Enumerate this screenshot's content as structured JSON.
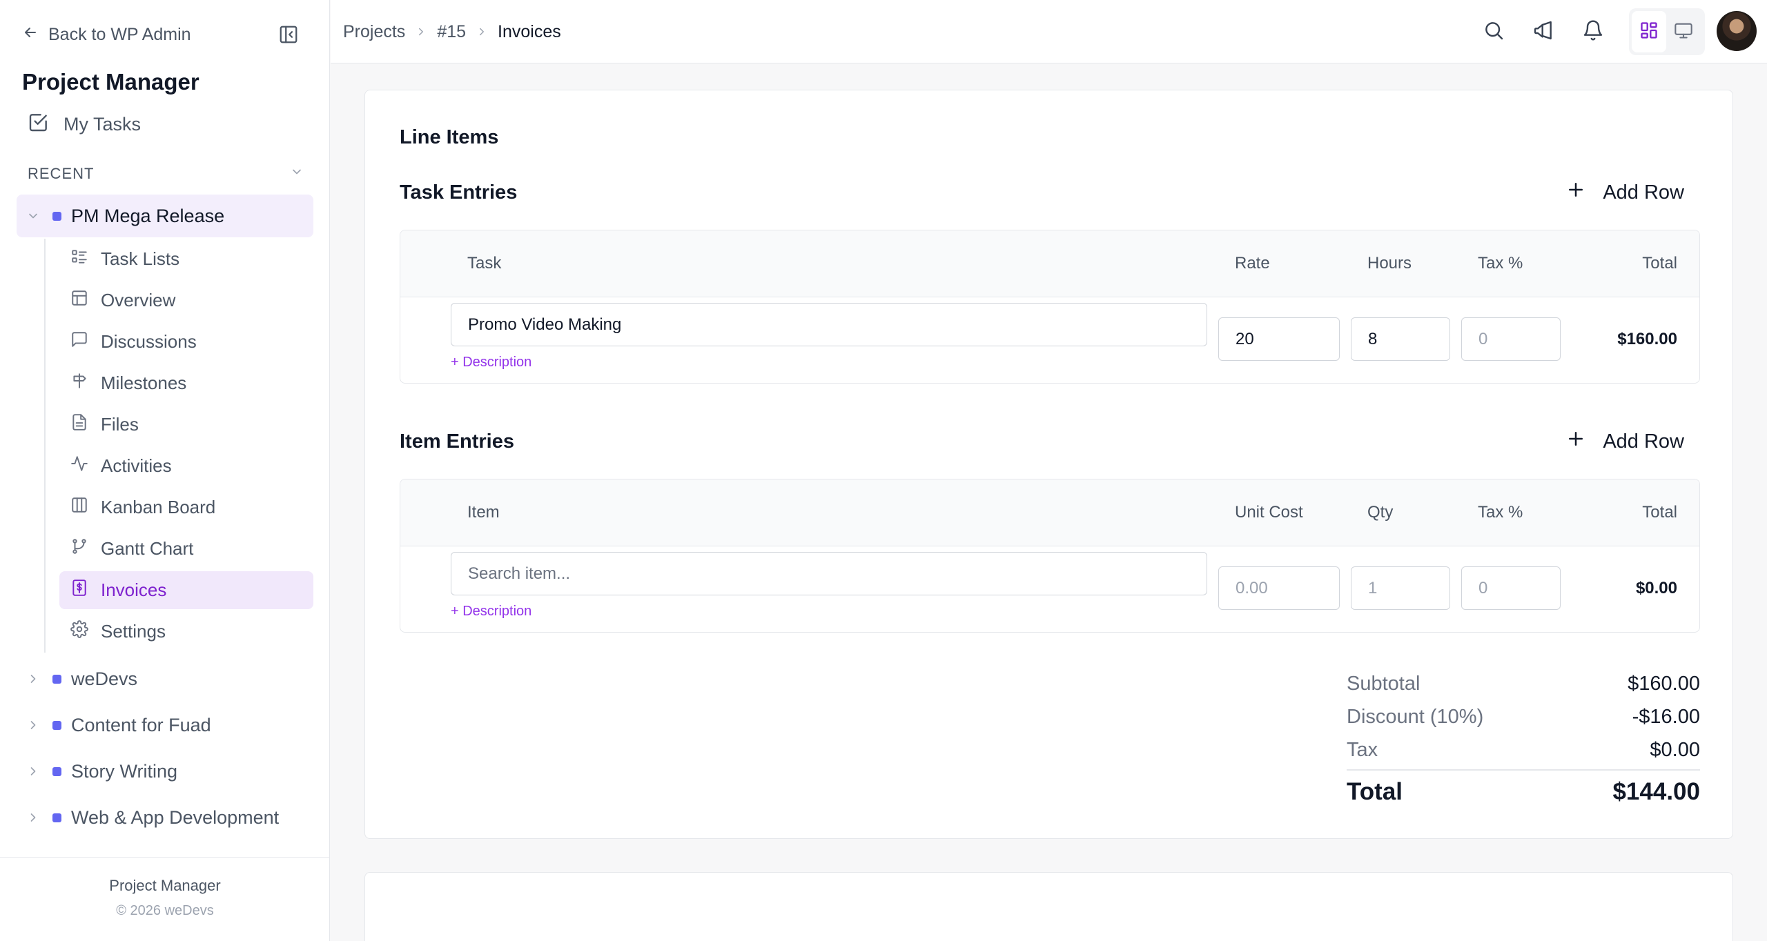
{
  "sidebar": {
    "back_label": "Back to WP Admin",
    "app_title": "Project Manager",
    "my_tasks": "My Tasks",
    "recent_label": "RECENT",
    "active_project": "PM Mega Release",
    "items": [
      {
        "label": "Task Lists",
        "icon": "list-icon"
      },
      {
        "label": "Overview",
        "icon": "layout-icon"
      },
      {
        "label": "Discussions",
        "icon": "message-icon"
      },
      {
        "label": "Milestones",
        "icon": "signpost-icon"
      },
      {
        "label": "Files",
        "icon": "file-icon"
      },
      {
        "label": "Activities",
        "icon": "activity-icon"
      },
      {
        "label": "Kanban Board",
        "icon": "columns-icon"
      },
      {
        "label": "Gantt Chart",
        "icon": "branch-icon"
      },
      {
        "label": "Invoices",
        "icon": "invoice-icon"
      },
      {
        "label": "Settings",
        "icon": "gear-icon"
      }
    ],
    "other_projects": [
      "weDevs",
      "Content for Fuad",
      "Story Writing",
      "Web & App Development"
    ],
    "footer_name": "Project Manager",
    "footer_copy": "© 2026 weDevs",
    "accent": "#6366f1",
    "active_color": "#7e22ce"
  },
  "breadcrumb": {
    "projects": "Projects",
    "project_id": "#15",
    "current": "Invoices"
  },
  "content": {
    "line_items_title": "Line Items",
    "task_entries": {
      "title": "Task Entries",
      "add_row": "Add Row",
      "columns": {
        "task": "Task",
        "rate": "Rate",
        "hours": "Hours",
        "tax": "Tax %",
        "total": "Total"
      },
      "row": {
        "task": "Promo Video Making",
        "rate": "20",
        "hours": "8",
        "tax_placeholder": "0",
        "description_link": "+ Description",
        "total": "$160.00"
      }
    },
    "item_entries": {
      "title": "Item Entries",
      "add_row": "Add Row",
      "columns": {
        "item": "Item",
        "unit_cost": "Unit Cost",
        "qty": "Qty",
        "tax": "Tax %",
        "total": "Total"
      },
      "row": {
        "item_placeholder": "Search item...",
        "unit_cost_placeholder": "0.00",
        "qty_placeholder": "1",
        "tax_placeholder": "0",
        "description_link": "+ Description",
        "total": "$0.00"
      }
    },
    "totals": {
      "subtotal_label": "Subtotal",
      "subtotal": "$160.00",
      "discount_label": "Discount (10%)",
      "discount": "-$16.00",
      "tax_label": "Tax",
      "tax": "$0.00",
      "total_label": "Total",
      "total": "$144.00"
    }
  }
}
